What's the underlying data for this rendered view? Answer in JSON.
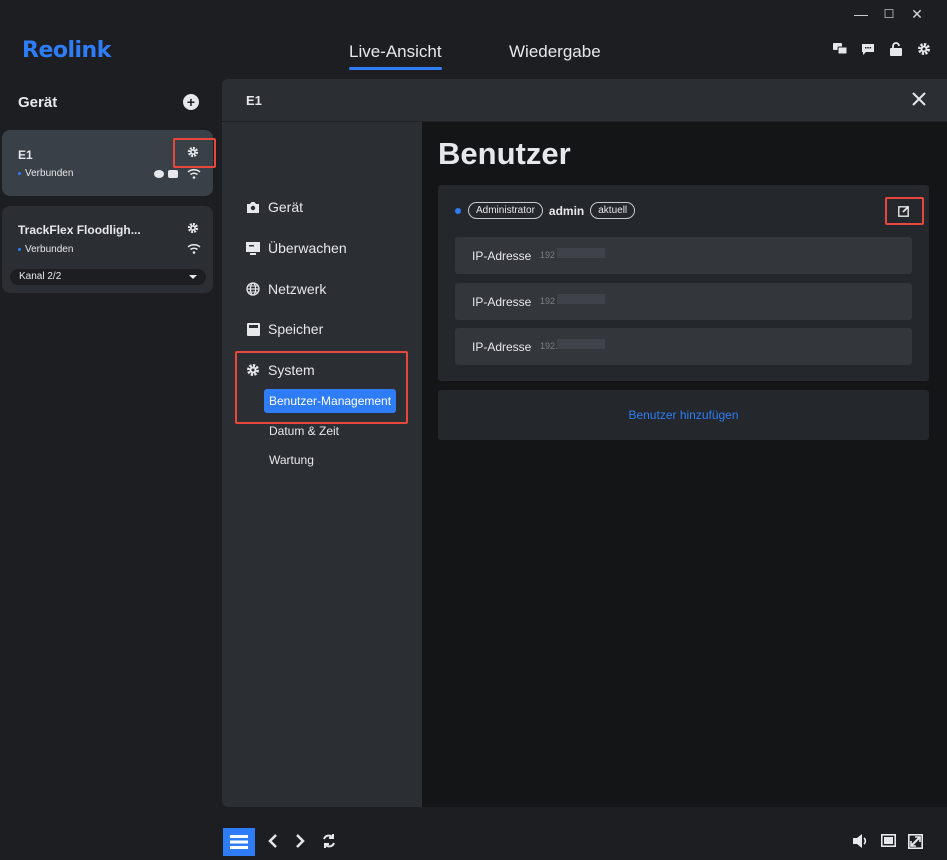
{
  "window": {
    "minimize_glyph": "—",
    "maximize_glyph": "☐",
    "close_glyph": "✕"
  },
  "app": {
    "logo": "Reolink",
    "tabs": [
      {
        "label": "Live-Ansicht",
        "active": true
      },
      {
        "label": "Wiedergabe",
        "active": false
      }
    ],
    "top_icons": [
      "chat-translate-icon",
      "message-icon",
      "lock-icon",
      "gear-icon"
    ]
  },
  "sidebar": {
    "title": "Gerät",
    "devices": [
      {
        "name": "E1",
        "status": "Verbunden",
        "selected": true
      },
      {
        "name": "TrackFlex Floodligh...",
        "status": "Verbunden",
        "channel": "Kanal 2/2",
        "selected": false
      }
    ]
  },
  "modal": {
    "title": "E1",
    "nav": [
      {
        "label": "Gerät",
        "icon": "camera-icon"
      },
      {
        "label": "Überwachen",
        "icon": "monitor-icon"
      },
      {
        "label": "Netzwerk",
        "icon": "globe-icon"
      },
      {
        "label": "Speicher",
        "icon": "storage-icon"
      },
      {
        "label": "System",
        "icon": "gear-icon"
      }
    ],
    "system_sub": [
      {
        "label": "Benutzer-Management",
        "active": true
      },
      {
        "label": "Datum & Zeit",
        "active": false
      },
      {
        "label": "Wartung",
        "active": false
      }
    ],
    "content": {
      "title": "Benutzer",
      "user": {
        "role": "Administrator",
        "name": "admin",
        "badge": "aktuell"
      },
      "ip_rows": [
        {
          "label": "IP-Adresse",
          "value": "192"
        },
        {
          "label": "IP-Adresse",
          "value": "192"
        },
        {
          "label": "IP-Adresse",
          "value": "192."
        }
      ],
      "add_user_label": "Benutzer hinzufügen"
    }
  },
  "colors": {
    "accent": "#2f7df6",
    "highlight": "#e8483b"
  }
}
